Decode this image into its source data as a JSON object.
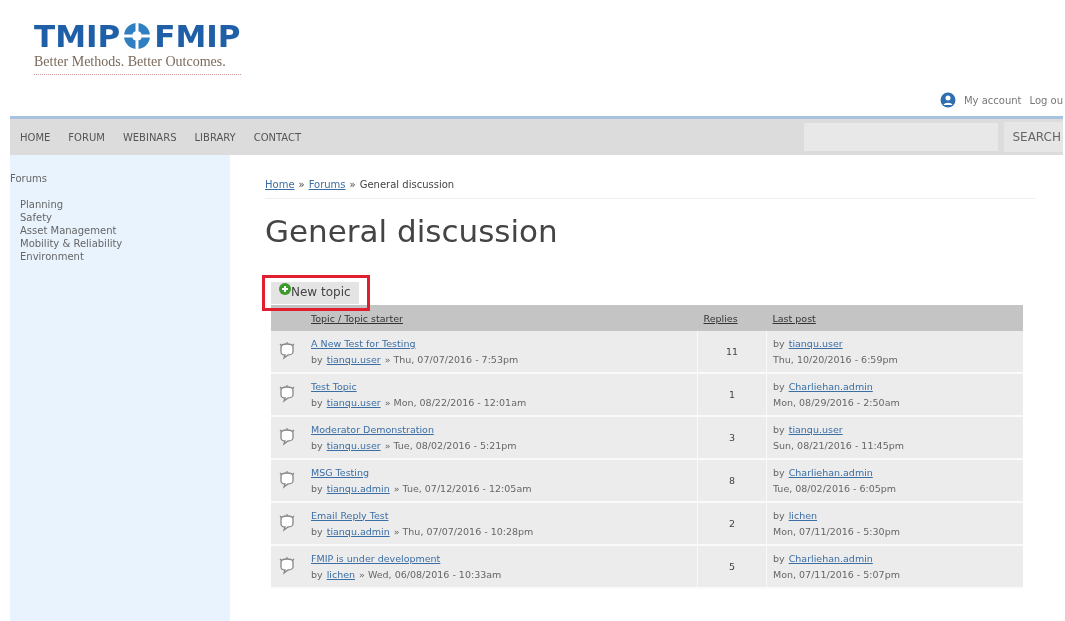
{
  "logo": {
    "name": "TMIP",
    "name2": "FMIP",
    "tagline": "Better Methods. Better Outcomes."
  },
  "user_links": [
    "My account",
    "Log ou"
  ],
  "nav": [
    "HOME",
    "FORUM",
    "WEBINARS",
    "LIBRARY",
    "CONTACT"
  ],
  "search": {
    "button": "SEARCH"
  },
  "sidebar": {
    "title": "Forums",
    "items": [
      "Planning",
      "Safety",
      "Asset Management",
      "Mobility & Reliability",
      "Environment"
    ]
  },
  "breadcrumb": [
    {
      "label": "Home",
      "link": true
    },
    {
      "separator": "»",
      "label": "Forums",
      "link": true
    },
    {
      "separator": "»",
      "label": "General discussion",
      "link": false
    }
  ],
  "page_title": "General discussion",
  "new_topic_button": "New topic",
  "table": {
    "columns": [
      "Topic / Topic starter",
      "Replies",
      "Last post"
    ],
    "rows": [
      {
        "title": "A New Test for Testing",
        "by": "by",
        "starter": "tianqu.user",
        "date": "» Thu, 07/07/2016 - 7:53pm",
        "replies": "11",
        "last_by_prefix": "by",
        "last_by": "tianqu.user",
        "last_date": "Thu, 10/20/2016 - 6:59pm"
      },
      {
        "title": "Test Topic",
        "by": "by",
        "starter": "tianqu.user",
        "date": "» Mon, 08/22/2016 - 12:01am",
        "replies": "1",
        "last_by_prefix": "by",
        "last_by": "Charliehan.admin",
        "last_date": "Mon, 08/29/2016 - 2:50am"
      },
      {
        "title": "Moderator Demonstration",
        "by": "by",
        "starter": "tianqu.user",
        "date": "» Tue, 08/02/2016 - 5:21pm",
        "replies": "3",
        "last_by_prefix": "by",
        "last_by": "tianqu.user",
        "last_date": "Sun, 08/21/2016 - 11:45pm"
      },
      {
        "title": "MSG Testing",
        "by": "by",
        "starter": "tianqu.admin",
        "date": "» Tue, 07/12/2016 - 12:05am",
        "replies": "8",
        "last_by_prefix": "by",
        "last_by": "Charliehan.admin",
        "last_date": "Tue, 08/02/2016 - 6:05pm"
      },
      {
        "title": "Email Reply Test",
        "by": "by",
        "starter": "tianqu.admin",
        "date": "» Thu, 07/07/2016 - 10:28pm",
        "replies": "2",
        "last_by_prefix": "by",
        "last_by": "lichen",
        "last_date": "Mon, 07/11/2016 - 5:30pm"
      },
      {
        "title": "FMIP is under development",
        "by": "by",
        "starter": "lichen",
        "date": "» Wed, 06/08/2016 - 10:33am",
        "replies": "5",
        "last_by_prefix": "by",
        "last_by": "Charliehan.admin",
        "last_date": "Mon, 07/11/2016 - 5:07pm"
      }
    ]
  }
}
